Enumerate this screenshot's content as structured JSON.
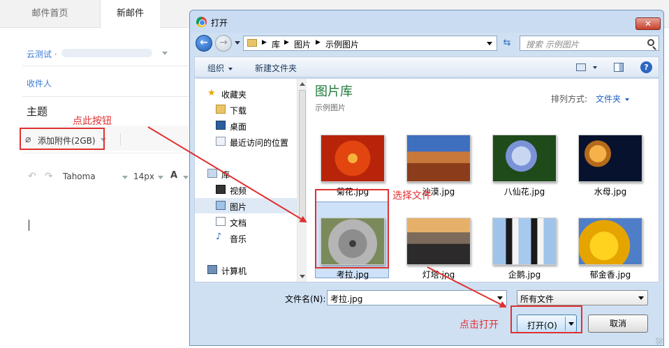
{
  "mail": {
    "tabs": [
      {
        "label": "邮件首页"
      },
      {
        "label": "新邮件"
      }
    ],
    "from_prefix": "云测试 ·",
    "recipient_label": "收件人",
    "subject_label": "主题",
    "attach_label": "添加附件(2GB)",
    "font_name": "Tahoma",
    "font_size": "14px",
    "font_color_letter": "A"
  },
  "annotations": {
    "click_button": "点此按钮",
    "select_file": "选择文件",
    "click_open": "点击打开",
    "color": "#e03030"
  },
  "dialog": {
    "title": "打开",
    "close_glyph": "✕",
    "breadcrumb": [
      "库",
      "图片",
      "示例图片"
    ],
    "search_placeholder": "搜索 示例图片",
    "commands": {
      "organize": "组织",
      "new_folder": "新建文件夹"
    },
    "nav_tree": [
      {
        "label": "收藏夹",
        "icon": "star-icon"
      },
      {
        "label": "下载",
        "icon": "download-folder-icon"
      },
      {
        "label": "桌面",
        "icon": "desktop-icon"
      },
      {
        "label": "最近访问的位置",
        "icon": "recent-places-icon"
      },
      {
        "label": "库",
        "icon": "libraries-icon"
      },
      {
        "label": "视频",
        "icon": "video-icon"
      },
      {
        "label": "图片",
        "icon": "pictures-icon",
        "selected": true
      },
      {
        "label": "文档",
        "icon": "documents-icon"
      },
      {
        "label": "音乐",
        "icon": "music-icon"
      },
      {
        "label": "计算机",
        "icon": "computer-icon"
      }
    ],
    "library_title": "图片库",
    "library_subtitle": "示例图片",
    "sort_label": "排列方式:",
    "sort_value": "文件夹",
    "files": [
      {
        "name": "菊花.jpg"
      },
      {
        "name": "沙漠.jpg"
      },
      {
        "name": "八仙花.jpg"
      },
      {
        "name": "水母.jpg"
      },
      {
        "name": "考拉.jpg",
        "selected": true
      },
      {
        "name": "灯塔.jpg"
      },
      {
        "name": "企鹅.jpg"
      },
      {
        "name": "郁金香.jpg"
      }
    ],
    "filename_label": "文件名(N):",
    "filename_value": "考拉.jpg",
    "filetype_value": "所有文件",
    "open_button": "打开(O)",
    "cancel_button": "取消",
    "colors": {
      "frame": "#cfe0f3",
      "accent_blue": "#2d67c0",
      "library_green": "#1e7a3a",
      "selection": "#cde1f8"
    }
  }
}
